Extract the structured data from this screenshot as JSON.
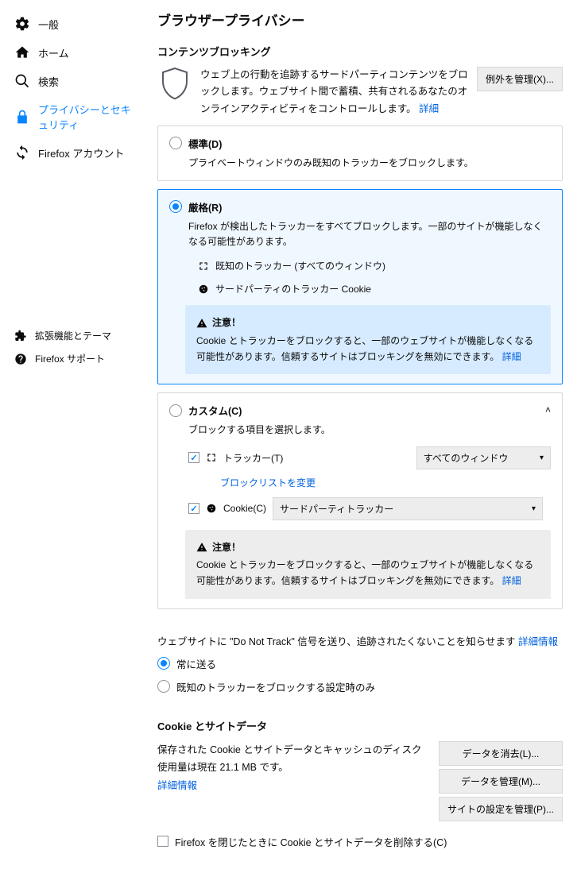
{
  "sidebar": {
    "items": [
      {
        "label": "一般"
      },
      {
        "label": "ホーム"
      },
      {
        "label": "検索"
      },
      {
        "label": "プライバシーとセキュリティ"
      },
      {
        "label": "Firefox アカウント"
      }
    ],
    "footer": [
      {
        "label": "拡張機能とテーマ"
      },
      {
        "label": "Firefox サポート"
      }
    ]
  },
  "page": {
    "title": "ブラウザープライバシー"
  },
  "cb": {
    "heading": "コンテンツブロッキング",
    "desc": "ウェブ上の行動を追跡するサードパーティコンテンツをブロックします。ウェブサイト間で蓄積、共有されるあなたのオンラインアクティビティをコントロールします。 ",
    "detail": "詳細",
    "manage_btn": "例外を管理(X)..."
  },
  "opts": {
    "standard": {
      "title": "標準(D)",
      "sub": "プライベートウィンドウのみ既知のトラッカーをブロックします。"
    },
    "strict": {
      "title": "厳格(R)",
      "sub": "Firefox が検出したトラッカーをすべてブロックします。一部のサイトが機能しなくなる可能性があります。",
      "known": "既知のトラッカー (すべてのウィンドウ)",
      "third": "サードパーティのトラッカー Cookie"
    },
    "custom": {
      "title": "カスタム(C)",
      "sub": "ブロックする項目を選択します。",
      "tracker_label": "トラッカー(T)",
      "tracker_sel": "すべてのウィンドウ",
      "change_list": "ブロックリストを変更",
      "cookie_label": "Cookie(C)",
      "cookie_sel": "サードパーティトラッカー"
    },
    "warning": {
      "head": "注意！",
      "body": "Cookie とトラッカーをブロックすると、一部のウェブサイトが機能しなくなる可能性があります。信頼するサイトはブロッキングを無効にできます。 ",
      "detail": "詳細"
    }
  },
  "dnt": {
    "text": "ウェブサイトに \"Do Not Track\" 信号を送り、追跡されたくないことを知らせます ",
    "detail": "詳細情報",
    "always": "常に送る",
    "known_only": "既知のトラッカーをブロックする設定時のみ"
  },
  "cookies": {
    "heading": "Cookie とサイトデータ",
    "desc": "保存された Cookie とサイトデータとキャッシュのディスク使用量は現在 21.1 MB です。",
    "detail": "詳細情報",
    "clear_btn": "データを消去(L)...",
    "manage_btn": "データを管理(M)...",
    "perm_btn": "サイトの設定を管理(P)...",
    "delete_on_close": "Firefox を閉じたときに Cookie とサイトデータを削除する(C)"
  }
}
